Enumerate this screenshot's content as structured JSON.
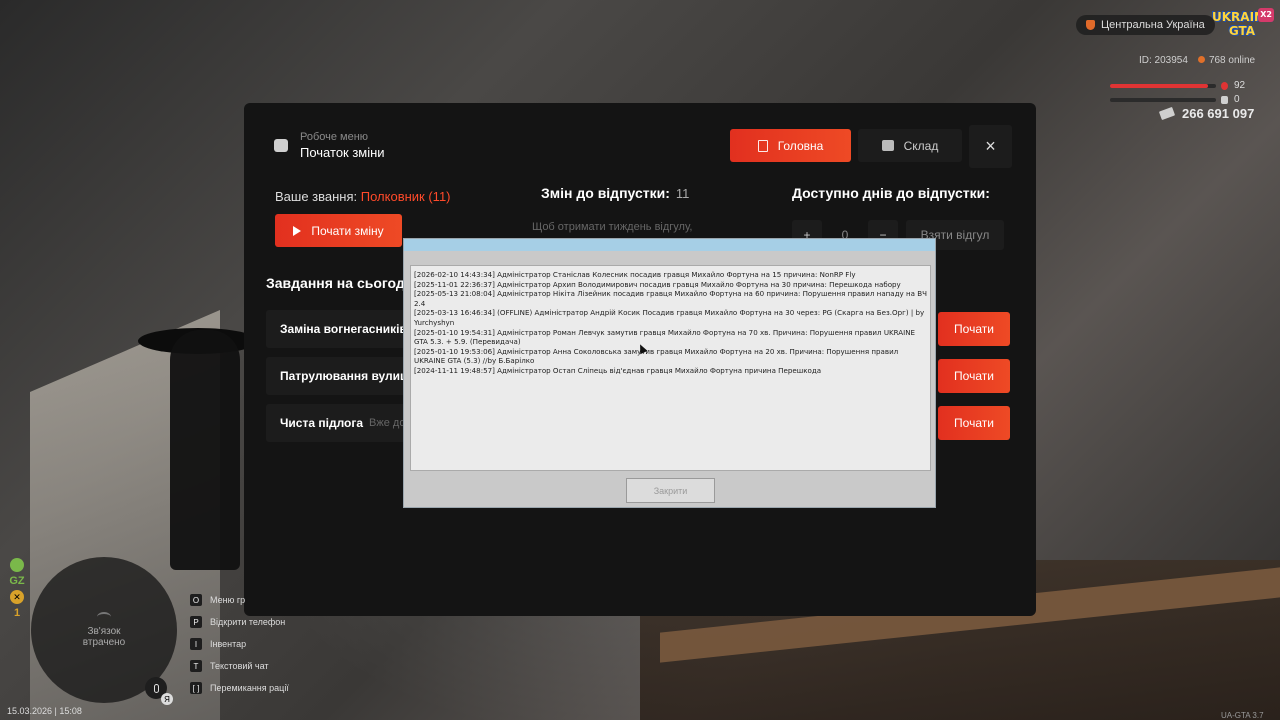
{
  "hud": {
    "region": "Центральна Україна",
    "logo": "UKRAINE GTA",
    "logo_badge": "X2",
    "player_id": "ID: 203954",
    "online": "768 online",
    "health": {
      "value": "92",
      "fraction": 0.92,
      "color": "#e03434"
    },
    "armor": {
      "value": "0",
      "fraction": 0.0,
      "color": "#cfcfcf"
    },
    "money": "266 691 097"
  },
  "panel": {
    "menu_sub": "Робоче меню",
    "menu_title": "Початок зміни",
    "tab_main": "Головна",
    "tab_store": "Склад",
    "close_icon": "×",
    "rank_label": "Ваше звання:",
    "rank_value": "Полковник (11)",
    "start_shift": "Почати зміну",
    "shifts_label": "Змін до відпустки:",
    "shifts_value": "11",
    "shifts_note": "Щоб отримати тиждень відгулу,",
    "days_label": "Доступно днів до відпустки:",
    "days_plus": "+",
    "days_value": "0",
    "days_minus": "−",
    "take_leave": "Взяти відгул",
    "tasks_heading": "Завдання на сьогод",
    "tasks": [
      {
        "name": "Заміна вогнегасників",
        "sub": "",
        "button": "Почати"
      },
      {
        "name": "Патрулювання вулиць",
        "sub": "",
        "button": "Почати"
      },
      {
        "name": "Чиста підлога",
        "sub": "Вже до",
        "button": "Почати"
      }
    ],
    "accent": "#e8361f"
  },
  "dialog": {
    "log": [
      "[2026-02-10 14:43:34] Адміністратор Станіслав Колесник посадив гравця Михайло Фортуна на 15 причина: NonRP Fly",
      "[2025-11-01 22:36:37] Адміністратор Архип Володимирович посадив гравця Михайло Фортуна на 30 причина: Перешкода набору",
      "[2025-05-13 21:08:04] Адміністратор Нікіта Лізейник посадив гравця Михайло Фортуна на 60 причина: Порушення правил нападу на ВЧ 2.4",
      "[2025-03-13 16:46:34] (OFFLINE) Адміністратор Андрій Косик Посадив гравця Михайло Фортуна на 30 через: PG (Скарга на Без.Орг) | by Yurchyshyn",
      "[2025-01-10 19:54:31] Адміністратор Роман Левчук замутив гравця Михайло Фортуна на 70 хв. Причина: Порушення правил UKRAINE GTA 5.3. + 5.9. (Перевидача)",
      "[2025-01-10 19:53:06] Адміністратор Анна Соколовська замутив гравця Михайло Фортуна на 20 хв. Причина: Порушення правил UKRAINE GTA (5.3) //by Б.Барілко",
      "[2024-11-11 19:48:57] Адміністратор Остап Сліпець від'єднав гравця Михайло Фортуна причина Перешкода"
    ],
    "close_label": "Закрити"
  },
  "bottom": {
    "gz": "GZ",
    "gz_count": "1",
    "radar_text": "Зв'язок втрачено",
    "mic_badge": "Я",
    "hints": [
      {
        "key": "O",
        "label": "Меню гр"
      },
      {
        "key": "P",
        "label": "Відкрити телефон"
      },
      {
        "key": "I",
        "label": "Інвентар"
      },
      {
        "key": "T",
        "label": "Текстовий чат"
      },
      {
        "key": "[ ]",
        "label": "Перемикання рації"
      }
    ],
    "datetime": "15.03.2026 | 15:08",
    "version": "UA-GTA 3.7"
  }
}
